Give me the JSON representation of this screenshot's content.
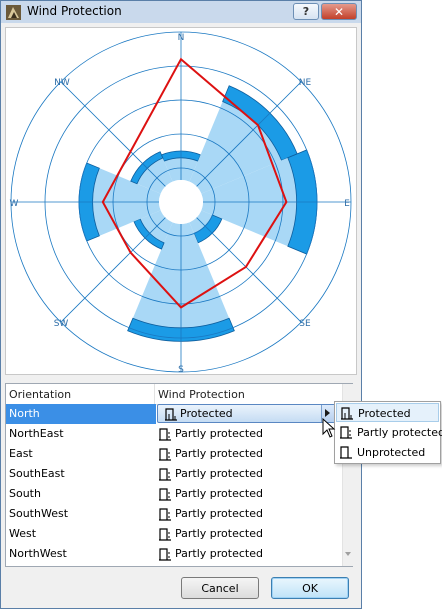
{
  "window": {
    "title": "Wind Protection",
    "help_glyph": "?",
    "close_glyph": "✕"
  },
  "chart": {
    "compass_labels": {
      "n": "N",
      "ne": "NE",
      "e": "E",
      "se": "SE",
      "s": "S",
      "sw": "SW",
      "w": "W",
      "nw": "NW"
    },
    "colors": {
      "ring": "#1a78c2",
      "light_fill": "#a9d8f6",
      "dark_fill": "#1b9be6",
      "outline": "#dd1111"
    }
  },
  "chart_data": {
    "type": "radar",
    "categories": [
      "N",
      "NE",
      "E",
      "SE",
      "S",
      "SW",
      "W",
      "NW"
    ],
    "series": [
      {
        "values": [
          4.2,
          3.2,
          3.1,
          2.7,
          3.1,
          2.1,
          2.3,
          2.1
        ]
      },
      {
        "values": [
          1.3,
          3.2,
          3.4,
          1.0,
          3.7,
          1.3,
          2.6,
          1.4
        ]
      },
      {
        "values": [
          0.2,
          0.5,
          0.6,
          0.3,
          0.4,
          0.2,
          0.4,
          0.2
        ]
      }
    ],
    "rlim": [
      0,
      5
    ]
  },
  "table": {
    "headers": {
      "orientation": "Orientation",
      "wind_protection": "Wind Protection"
    },
    "rows": [
      {
        "orientation": "North",
        "protection": "Protected"
      },
      {
        "orientation": "NorthEast",
        "protection": "Partly protected"
      },
      {
        "orientation": "East",
        "protection": "Partly protected"
      },
      {
        "orientation": "SouthEast",
        "protection": "Partly protected"
      },
      {
        "orientation": "South",
        "protection": "Partly protected"
      },
      {
        "orientation": "SouthWest",
        "protection": "Partly protected"
      },
      {
        "orientation": "West",
        "protection": "Partly protected"
      },
      {
        "orientation": "NorthWest",
        "protection": "Partly protected"
      }
    ],
    "selected_row": "North"
  },
  "dropdown": {
    "options": [
      "Protected",
      "Partly protected",
      "Unprotected"
    ],
    "highlighted": "Protected"
  },
  "buttons": {
    "cancel": "Cancel",
    "ok": "OK"
  }
}
